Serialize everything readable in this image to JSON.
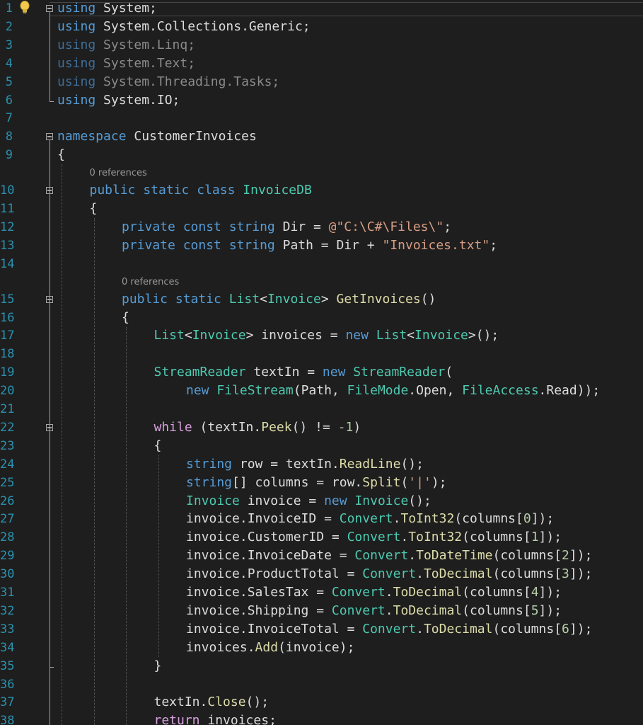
{
  "editor": {
    "language": "csharp",
    "colors": {
      "background": "#1e1e1e",
      "line_number": "#2b91af",
      "keyword": "#569cd6",
      "type": "#4ec9b0",
      "string": "#d69d85",
      "method": "#dcdcaa",
      "control": "#d8a0df",
      "number": "#b5cea8",
      "identifier": "#dcdcdc",
      "codelens": "#999999"
    },
    "codelens": [
      {
        "text": "0 references",
        "before_line": 10
      },
      {
        "text": "0 references",
        "before_line": 15
      }
    ],
    "lines": [
      {
        "n": "1",
        "indent": 0,
        "tokens": [
          {
            "t": "using",
            "c": "kw"
          },
          {
            "t": " System;",
            "c": "id"
          }
        ]
      },
      {
        "n": "2",
        "indent": 0,
        "tokens": [
          {
            "t": "using",
            "c": "kw"
          },
          {
            "t": " System.Collections.Generic;",
            "c": "id"
          }
        ]
      },
      {
        "n": "3",
        "indent": 0,
        "tokens": [
          {
            "t": "using",
            "c": "dkw"
          },
          {
            "t": " System.Linq;",
            "c": "dim"
          }
        ]
      },
      {
        "n": "4",
        "indent": 0,
        "tokens": [
          {
            "t": "using",
            "c": "dkw"
          },
          {
            "t": " System.Text;",
            "c": "dim"
          }
        ]
      },
      {
        "n": "5",
        "indent": 0,
        "tokens": [
          {
            "t": "using",
            "c": "dkw"
          },
          {
            "t": " System.Threading.Tasks;",
            "c": "dim"
          }
        ]
      },
      {
        "n": "6",
        "indent": 0,
        "tokens": [
          {
            "t": "using",
            "c": "kw"
          },
          {
            "t": " System.IO;",
            "c": "id"
          }
        ]
      },
      {
        "n": "7",
        "indent": 0,
        "tokens": []
      },
      {
        "n": "8",
        "indent": 0,
        "tokens": [
          {
            "t": "namespace",
            "c": "kw"
          },
          {
            "t": " CustomerInvoices",
            "c": "id"
          }
        ]
      },
      {
        "n": "9",
        "indent": 0,
        "tokens": [
          {
            "t": "{",
            "c": "id"
          }
        ]
      },
      {
        "n": "10",
        "indent": 1,
        "tokens": [
          {
            "t": "public",
            "c": "kw"
          },
          {
            "t": " ",
            "c": "id"
          },
          {
            "t": "static",
            "c": "kw"
          },
          {
            "t": " ",
            "c": "id"
          },
          {
            "t": "class",
            "c": "kw"
          },
          {
            "t": " ",
            "c": "id"
          },
          {
            "t": "InvoiceDB",
            "c": "ty"
          }
        ]
      },
      {
        "n": "11",
        "indent": 1,
        "tokens": [
          {
            "t": "{",
            "c": "id"
          }
        ]
      },
      {
        "n": "12",
        "indent": 2,
        "tokens": [
          {
            "t": "private",
            "c": "kw"
          },
          {
            "t": " ",
            "c": "id"
          },
          {
            "t": "const",
            "c": "kw"
          },
          {
            "t": " ",
            "c": "id"
          },
          {
            "t": "string",
            "c": "kw"
          },
          {
            "t": " Dir = ",
            "c": "id"
          },
          {
            "t": "@\"C:\\C#\\Files\\\"",
            "c": "str"
          },
          {
            "t": ";",
            "c": "id"
          }
        ]
      },
      {
        "n": "13",
        "indent": 2,
        "tokens": [
          {
            "t": "private",
            "c": "kw"
          },
          {
            "t": " ",
            "c": "id"
          },
          {
            "t": "const",
            "c": "kw"
          },
          {
            "t": " ",
            "c": "id"
          },
          {
            "t": "string",
            "c": "kw"
          },
          {
            "t": " Path = Dir + ",
            "c": "id"
          },
          {
            "t": "\"Invoices.txt\"",
            "c": "str"
          },
          {
            "t": ";",
            "c": "id"
          }
        ]
      },
      {
        "n": "14",
        "indent": 0,
        "tokens": []
      },
      {
        "n": "15",
        "indent": 2,
        "tokens": [
          {
            "t": "public",
            "c": "kw"
          },
          {
            "t": " ",
            "c": "id"
          },
          {
            "t": "static",
            "c": "kw"
          },
          {
            "t": " ",
            "c": "id"
          },
          {
            "t": "List",
            "c": "ty"
          },
          {
            "t": "<",
            "c": "id"
          },
          {
            "t": "Invoice",
            "c": "ty"
          },
          {
            "t": "> ",
            "c": "id"
          },
          {
            "t": "GetInvoices",
            "c": "fn"
          },
          {
            "t": "()",
            "c": "id"
          }
        ]
      },
      {
        "n": "16",
        "indent": 2,
        "tokens": [
          {
            "t": "{",
            "c": "id"
          }
        ]
      },
      {
        "n": "17",
        "indent": 3,
        "tokens": [
          {
            "t": "List",
            "c": "ty"
          },
          {
            "t": "<",
            "c": "id"
          },
          {
            "t": "Invoice",
            "c": "ty"
          },
          {
            "t": "> invoices = ",
            "c": "id"
          },
          {
            "t": "new",
            "c": "kw"
          },
          {
            "t": " ",
            "c": "id"
          },
          {
            "t": "List",
            "c": "ty"
          },
          {
            "t": "<",
            "c": "id"
          },
          {
            "t": "Invoice",
            "c": "ty"
          },
          {
            "t": ">();",
            "c": "id"
          }
        ]
      },
      {
        "n": "18",
        "indent": 0,
        "tokens": []
      },
      {
        "n": "19",
        "indent": 3,
        "tokens": [
          {
            "t": "StreamReader",
            "c": "ty"
          },
          {
            "t": " textIn = ",
            "c": "id"
          },
          {
            "t": "new",
            "c": "kw"
          },
          {
            "t": " ",
            "c": "id"
          },
          {
            "t": "StreamReader",
            "c": "ty"
          },
          {
            "t": "(",
            "c": "id"
          }
        ]
      },
      {
        "n": "20",
        "indent": 4,
        "tokens": [
          {
            "t": "new",
            "c": "kw"
          },
          {
            "t": " ",
            "c": "id"
          },
          {
            "t": "FileStream",
            "c": "ty"
          },
          {
            "t": "(Path, ",
            "c": "id"
          },
          {
            "t": "FileMode",
            "c": "ty"
          },
          {
            "t": ".Open, ",
            "c": "id"
          },
          {
            "t": "FileAccess",
            "c": "ty"
          },
          {
            "t": ".Read));",
            "c": "id"
          }
        ]
      },
      {
        "n": "21",
        "indent": 0,
        "tokens": []
      },
      {
        "n": "22",
        "indent": 3,
        "tokens": [
          {
            "t": "while",
            "c": "ctl"
          },
          {
            "t": " (textIn.",
            "c": "id"
          },
          {
            "t": "Peek",
            "c": "fn"
          },
          {
            "t": "() != ",
            "c": "id"
          },
          {
            "t": "-1",
            "c": "num"
          },
          {
            "t": ")",
            "c": "id"
          }
        ]
      },
      {
        "n": "23",
        "indent": 3,
        "tokens": [
          {
            "t": "{",
            "c": "id"
          }
        ]
      },
      {
        "n": "24",
        "indent": 4,
        "tokens": [
          {
            "t": "string",
            "c": "kw"
          },
          {
            "t": " row = textIn.",
            "c": "id"
          },
          {
            "t": "ReadLine",
            "c": "fn"
          },
          {
            "t": "();",
            "c": "id"
          }
        ]
      },
      {
        "n": "25",
        "indent": 4,
        "tokens": [
          {
            "t": "string",
            "c": "kw"
          },
          {
            "t": "[] columns = row.",
            "c": "id"
          },
          {
            "t": "Split",
            "c": "fn"
          },
          {
            "t": "(",
            "c": "id"
          },
          {
            "t": "'|'",
            "c": "str"
          },
          {
            "t": ");",
            "c": "id"
          }
        ]
      },
      {
        "n": "26",
        "indent": 4,
        "tokens": [
          {
            "t": "Invoice",
            "c": "ty"
          },
          {
            "t": " invoice = ",
            "c": "id"
          },
          {
            "t": "new",
            "c": "kw"
          },
          {
            "t": " ",
            "c": "id"
          },
          {
            "t": "Invoice",
            "c": "ty"
          },
          {
            "t": "();",
            "c": "id"
          }
        ]
      },
      {
        "n": "27",
        "indent": 4,
        "tokens": [
          {
            "t": "invoice.InvoiceID = ",
            "c": "id"
          },
          {
            "t": "Convert",
            "c": "ty"
          },
          {
            "t": ".",
            "c": "id"
          },
          {
            "t": "ToInt32",
            "c": "fn"
          },
          {
            "t": "(columns[",
            "c": "id"
          },
          {
            "t": "0",
            "c": "num"
          },
          {
            "t": "]);",
            "c": "id"
          }
        ]
      },
      {
        "n": "28",
        "indent": 4,
        "tokens": [
          {
            "t": "invoice.CustomerID = ",
            "c": "id"
          },
          {
            "t": "Convert",
            "c": "ty"
          },
          {
            "t": ".",
            "c": "id"
          },
          {
            "t": "ToInt32",
            "c": "fn"
          },
          {
            "t": "(columns[",
            "c": "id"
          },
          {
            "t": "1",
            "c": "num"
          },
          {
            "t": "]);",
            "c": "id"
          }
        ]
      },
      {
        "n": "29",
        "indent": 4,
        "tokens": [
          {
            "t": "invoice.InvoiceDate = ",
            "c": "id"
          },
          {
            "t": "Convert",
            "c": "ty"
          },
          {
            "t": ".",
            "c": "id"
          },
          {
            "t": "ToDateTime",
            "c": "fn"
          },
          {
            "t": "(columns[",
            "c": "id"
          },
          {
            "t": "2",
            "c": "num"
          },
          {
            "t": "]);",
            "c": "id"
          }
        ]
      },
      {
        "n": "30",
        "indent": 4,
        "tokens": [
          {
            "t": "invoice.ProductTotal = ",
            "c": "id"
          },
          {
            "t": "Convert",
            "c": "ty"
          },
          {
            "t": ".",
            "c": "id"
          },
          {
            "t": "ToDecimal",
            "c": "fn"
          },
          {
            "t": "(columns[",
            "c": "id"
          },
          {
            "t": "3",
            "c": "num"
          },
          {
            "t": "]);",
            "c": "id"
          }
        ]
      },
      {
        "n": "31",
        "indent": 4,
        "tokens": [
          {
            "t": "invoice.SalesTax = ",
            "c": "id"
          },
          {
            "t": "Convert",
            "c": "ty"
          },
          {
            "t": ".",
            "c": "id"
          },
          {
            "t": "ToDecimal",
            "c": "fn"
          },
          {
            "t": "(columns[",
            "c": "id"
          },
          {
            "t": "4",
            "c": "num"
          },
          {
            "t": "]);",
            "c": "id"
          }
        ]
      },
      {
        "n": "32",
        "indent": 4,
        "tokens": [
          {
            "t": "invoice.Shipping = ",
            "c": "id"
          },
          {
            "t": "Convert",
            "c": "ty"
          },
          {
            "t": ".",
            "c": "id"
          },
          {
            "t": "ToDecimal",
            "c": "fn"
          },
          {
            "t": "(columns[",
            "c": "id"
          },
          {
            "t": "5",
            "c": "num"
          },
          {
            "t": "]);",
            "c": "id"
          }
        ]
      },
      {
        "n": "33",
        "indent": 4,
        "tokens": [
          {
            "t": "invoice.InvoiceTotal = ",
            "c": "id"
          },
          {
            "t": "Convert",
            "c": "ty"
          },
          {
            "t": ".",
            "c": "id"
          },
          {
            "t": "ToDecimal",
            "c": "fn"
          },
          {
            "t": "(columns[",
            "c": "id"
          },
          {
            "t": "6",
            "c": "num"
          },
          {
            "t": "]);",
            "c": "id"
          }
        ]
      },
      {
        "n": "34",
        "indent": 4,
        "tokens": [
          {
            "t": "invoices.",
            "c": "id"
          },
          {
            "t": "Add",
            "c": "fn"
          },
          {
            "t": "(invoice);",
            "c": "id"
          }
        ]
      },
      {
        "n": "35",
        "indent": 3,
        "tokens": [
          {
            "t": "}",
            "c": "id"
          }
        ]
      },
      {
        "n": "36",
        "indent": 0,
        "tokens": []
      },
      {
        "n": "37",
        "indent": 3,
        "tokens": [
          {
            "t": "textIn.",
            "c": "id"
          },
          {
            "t": "Close",
            "c": "fn"
          },
          {
            "t": "();",
            "c": "id"
          }
        ]
      },
      {
        "n": "38",
        "indent": 3,
        "tokens": [
          {
            "t": "return",
            "c": "ctl"
          },
          {
            "t": " invoices;",
            "c": "id"
          }
        ]
      }
    ]
  }
}
